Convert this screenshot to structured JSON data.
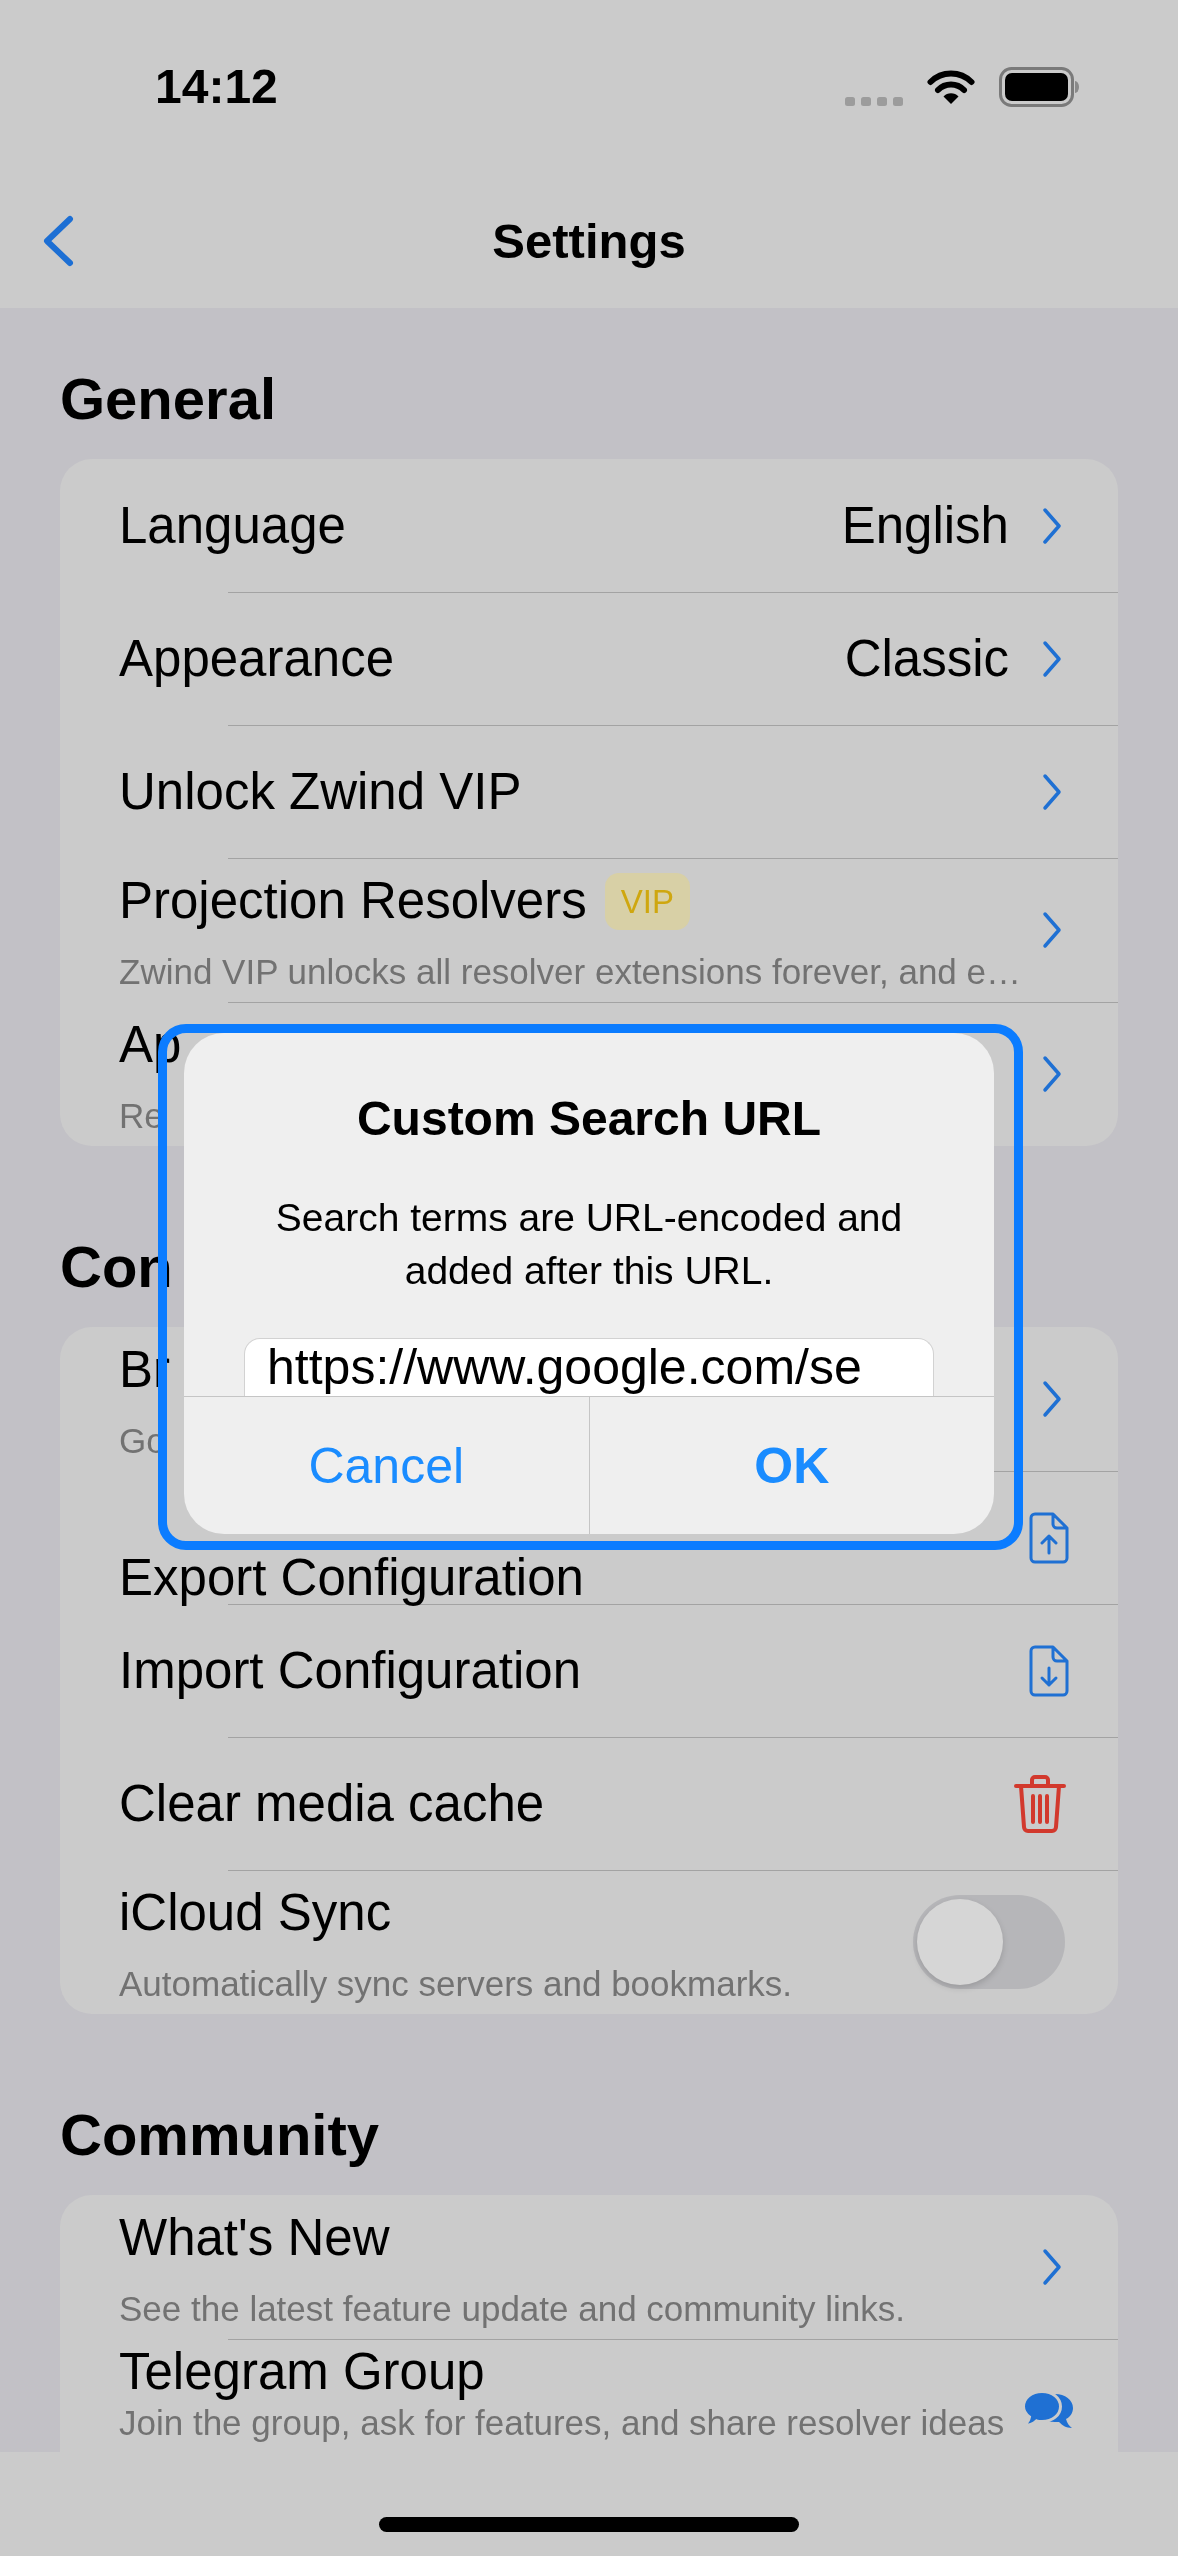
{
  "status_bar": {
    "time": "14:12"
  },
  "nav_bar": {
    "title": "Settings"
  },
  "sections": [
    {
      "title": "General",
      "rows": [
        {
          "kind": "chevron",
          "title": "Language",
          "value": "English"
        },
        {
          "kind": "chevron",
          "title": "Appearance",
          "value": "Classic"
        },
        {
          "kind": "chevron",
          "title": "Unlock Zwind VIP"
        },
        {
          "kind": "chevron",
          "title": "Projection Resolvers",
          "badge": "VIP",
          "subtitle": "Zwind VIP unlocks all resolver extensions forever, and e…"
        },
        {
          "kind": "chevron",
          "title": "Ap",
          "subtitle": "Re"
        }
      ]
    },
    {
      "title": "Con",
      "rows": [
        {
          "kind": "chevron",
          "title": "Br",
          "subtitle": "Go"
        },
        {
          "kind": "export",
          "title": "Export Configuration"
        },
        {
          "kind": "import",
          "title": "Import Configuration"
        },
        {
          "kind": "delete",
          "title": "Clear media cache"
        },
        {
          "kind": "toggle",
          "title": "iCloud Sync",
          "subtitle": "Automatically sync servers and bookmarks.",
          "on": false
        }
      ]
    },
    {
      "title": "Community",
      "rows": [
        {
          "kind": "chevron",
          "title": "What's New",
          "subtitle": "See the latest feature update and community links."
        },
        {
          "kind": "chat",
          "title": "Telegram Group",
          "subtitle": "Join the group, ask for features, and share resolver ideas"
        }
      ]
    }
  ],
  "dialog": {
    "title": "Custom Search URL",
    "message": "Search terms are URL-encoded and added after this URL.",
    "field": {
      "value": "https://www.google.com/se"
    },
    "buttons": [
      {
        "kind": "cancel",
        "label": "Cancel"
      },
      {
        "kind": "default",
        "label": "OK"
      }
    ]
  }
}
